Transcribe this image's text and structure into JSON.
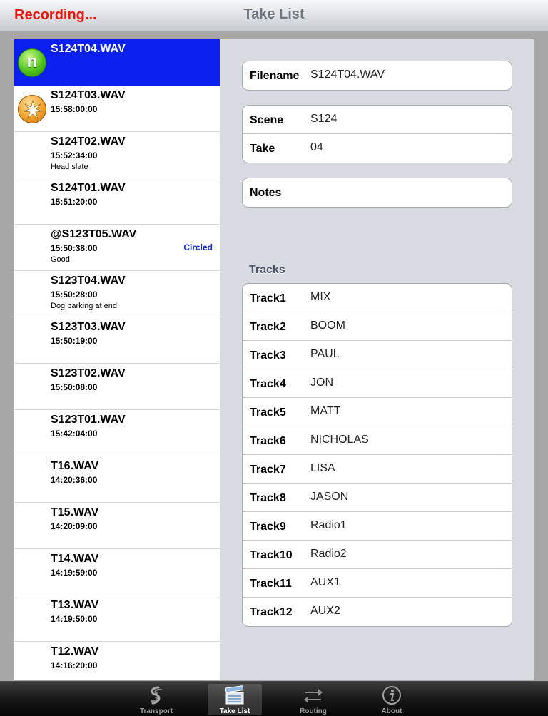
{
  "navbar": {
    "status": "Recording...",
    "title": "Take List"
  },
  "takes": [
    {
      "filename": "S124T04.WAV",
      "time": "",
      "note": "",
      "tag": "",
      "badge": "n",
      "badge_icon": "new-take-badge-icon",
      "selected": true
    },
    {
      "filename": "S124T03.WAV",
      "time": "15:58:00:00",
      "note": "",
      "tag": "",
      "badge": "",
      "badge_icon": "recording-star-icon",
      "selected": false
    },
    {
      "filename": "S124T02.WAV",
      "time": "15:52:34:00",
      "note": "Head slate",
      "tag": ""
    },
    {
      "filename": "S124T01.WAV",
      "time": "15:51:20:00",
      "note": "",
      "tag": ""
    },
    {
      "filename": "@S123T05.WAV",
      "time": "15:50:38:00",
      "note": "Good",
      "tag": "Circled"
    },
    {
      "filename": "S123T04.WAV",
      "time": "15:50:28:00",
      "note": "Dog barking at end",
      "tag": ""
    },
    {
      "filename": "S123T03.WAV",
      "time": "15:50:19:00",
      "note": "",
      "tag": ""
    },
    {
      "filename": "S123T02.WAV",
      "time": "15:50:08:00",
      "note": "",
      "tag": ""
    },
    {
      "filename": "S123T01.WAV",
      "time": "15:42:04:00",
      "note": "",
      "tag": ""
    },
    {
      "filename": "T16.WAV",
      "time": "14:20:36:00",
      "note": "",
      "tag": ""
    },
    {
      "filename": "T15.WAV",
      "time": "14:20:09:00",
      "note": "",
      "tag": ""
    },
    {
      "filename": "T14.WAV",
      "time": "14:19:59:00",
      "note": "",
      "tag": ""
    },
    {
      "filename": "T13.WAV",
      "time": "14:19:50:00",
      "note": "",
      "tag": ""
    },
    {
      "filename": "T12.WAV",
      "time": "14:16:20:00",
      "note": "",
      "tag": ""
    }
  ],
  "detail": {
    "filename": {
      "label": "Filename",
      "value": "S124T04.WAV"
    },
    "scene": {
      "label": "Scene",
      "value": "S124"
    },
    "take": {
      "label": "Take",
      "value": "04"
    },
    "notes": {
      "label": "Notes",
      "value": ""
    },
    "tracks_title": "Tracks",
    "tracks": [
      {
        "label": "Track1",
        "value": "MIX"
      },
      {
        "label": "Track2",
        "value": "BOOM"
      },
      {
        "label": "Track3",
        "value": "PAUL"
      },
      {
        "label": "Track4",
        "value": "JON"
      },
      {
        "label": "Track5",
        "value": "MATT"
      },
      {
        "label": "Track6",
        "value": "NICHOLAS"
      },
      {
        "label": "Track7",
        "value": "LISA"
      },
      {
        "label": "Track8",
        "value": "JASON"
      },
      {
        "label": "Track9",
        "value": "Radio1"
      },
      {
        "label": "Track10",
        "value": "Radio2"
      },
      {
        "label": "Track11",
        "value": "AUX1"
      },
      {
        "label": "Track12",
        "value": "AUX2"
      }
    ]
  },
  "tabbar": {
    "tabs": [
      {
        "label": "Transport",
        "icon": "transport-icon",
        "active": false
      },
      {
        "label": "Take List",
        "icon": "clapperboard-icon",
        "active": true
      },
      {
        "label": "Routing",
        "icon": "routing-arrows-icon",
        "active": false
      },
      {
        "label": "About",
        "icon": "info-icon",
        "active": false
      }
    ]
  },
  "colors": {
    "recording": "#e8180c",
    "selected_row": "#0a1ff0",
    "circled_tag": "#1430d8",
    "panel_bg": "#d8dbe1"
  }
}
